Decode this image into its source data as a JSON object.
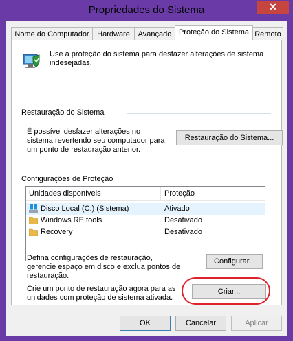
{
  "window": {
    "title": "Propriedades do Sistema",
    "close_glyph": "✕"
  },
  "tabs": [
    {
      "label": "Nome do Computador"
    },
    {
      "label": "Hardware"
    },
    {
      "label": "Avançado"
    },
    {
      "label": "Proteção do Sistema",
      "active": true
    },
    {
      "label": "Remoto"
    }
  ],
  "intro": {
    "text": "Use a proteção do sistema para desfazer alterações de sistema indesejadas.",
    "icon": "system-protection-shield-icon"
  },
  "restore": {
    "heading": "Restauração do Sistema",
    "description": "É possível desfazer alterações no sistema revertendo seu computador para um ponto de restauração anterior.",
    "button": "Restauração do Sistema..."
  },
  "protection": {
    "heading": "Configurações de Proteção",
    "columns": [
      "Unidades disponíveis",
      "Proteção"
    ],
    "drives": [
      {
        "name": "Disco Local (C:) (Sistema)",
        "status": "Ativado",
        "icon": "windows-drive-icon",
        "selected": true
      },
      {
        "name": "Windows RE tools",
        "status": "Desativado",
        "icon": "folder-icon"
      },
      {
        "name": "Recovery",
        "status": "Desativado",
        "icon": "folder-icon"
      }
    ],
    "configure_text": "Defina configurações de restauração, gerencie espaço em disco e exclua pontos de restauração.",
    "configure_button": "Configurar...",
    "create_text": "Crie um ponto de restauração agora para as unidades com proteção de sistema ativada.",
    "create_button": "Criar..."
  },
  "footer": {
    "ok": "OK",
    "cancel": "Cancelar",
    "apply": "Aplicar"
  },
  "colors": {
    "titlebar": "#6a3aa6",
    "close": "#c7453f",
    "highlight_oval": "#e0202a",
    "selection": "#e5f3ff"
  }
}
